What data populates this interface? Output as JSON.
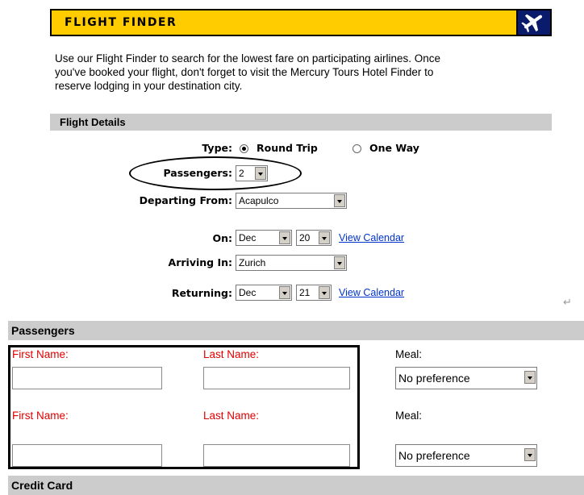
{
  "banner": {
    "title": "FLIGHT FINDER",
    "icon": "airplane-icon",
    "colors": {
      "background": "#ffcc00",
      "icon_bg": "#0a1b6b"
    }
  },
  "intro": {
    "line1": "Use our Flight Finder to search for the lowest fare on participating airlines. Once",
    "line2": "you've booked your flight, don't forget to visit the Mercury Tours Hotel Finder to",
    "line3": "reserve lodging in your destination city."
  },
  "flight_details": {
    "heading": "Flight Details",
    "type": {
      "label": "Type:",
      "options": [
        "Round Trip",
        "One Way"
      ],
      "selected": "Round Trip"
    },
    "passengers": {
      "label": "Passengers:",
      "value": "2"
    },
    "departing_from": {
      "label": "Departing From:",
      "value": "Acapulco"
    },
    "on": {
      "label": "On:",
      "month": "Dec",
      "day": "20",
      "calendar_link": "View Calendar"
    },
    "arriving_in": {
      "label": "Arriving In:",
      "value": "Zurich"
    },
    "returning": {
      "label": "Returning:",
      "month": "Dec",
      "day": "21",
      "calendar_link": "View Calendar"
    }
  },
  "passengers_section": {
    "heading": "Passengers",
    "rows": [
      {
        "first_label": "First Name:",
        "last_label": "Last Name:",
        "meal_label": "Meal:",
        "meal_value": "No preference"
      },
      {
        "first_label": "First Name:",
        "last_label": "Last Name:",
        "meal_label": "Meal:",
        "meal_value": "No preference"
      }
    ],
    "label_color": "#e00000"
  },
  "credit_card": {
    "heading": "Credit Card"
  },
  "misc": {
    "return_glyph": "↵"
  }
}
